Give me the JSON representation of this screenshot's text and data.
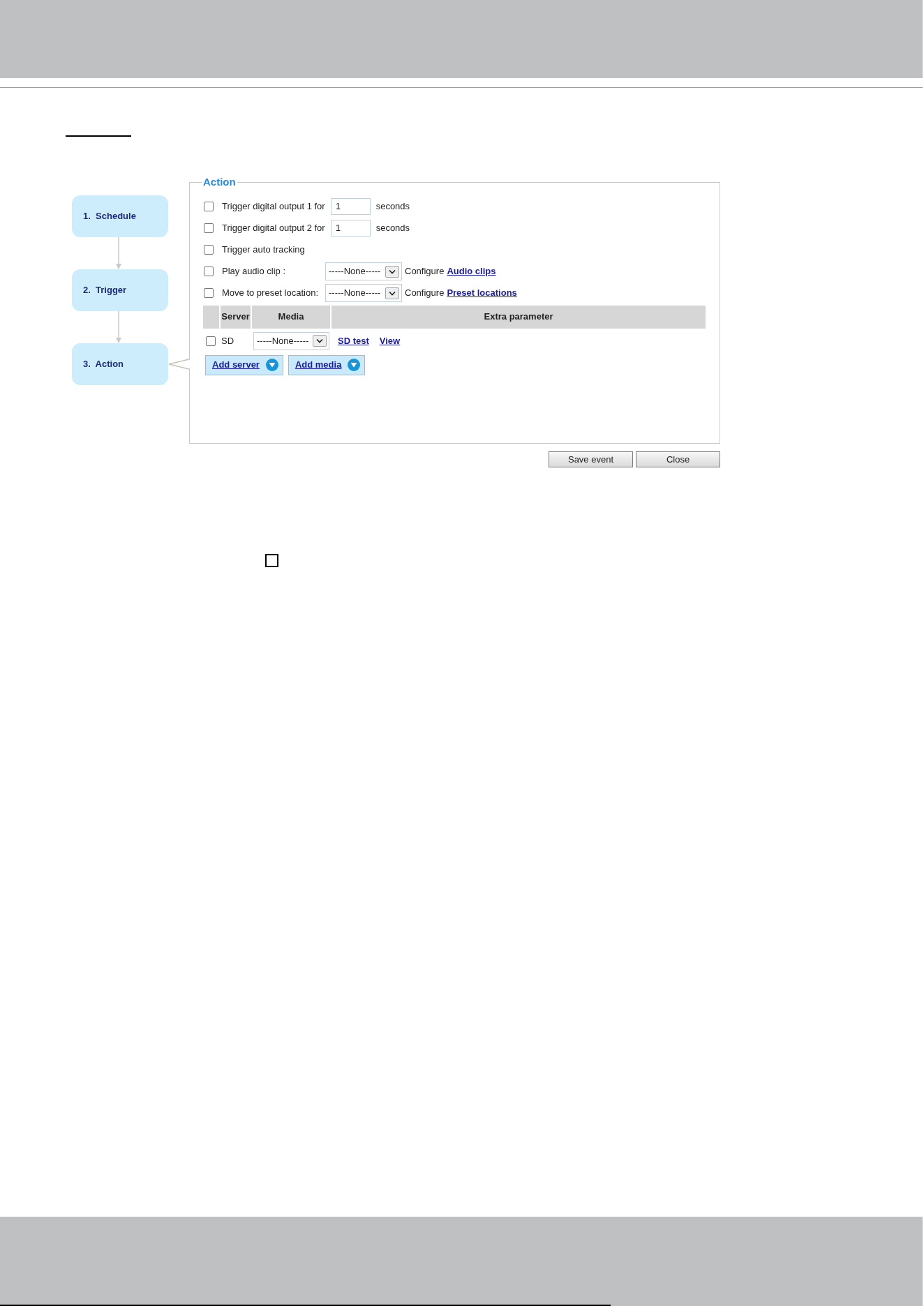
{
  "steps": [
    {
      "label": "1.  Schedule",
      "selected": false
    },
    {
      "label": "2.  Trigger",
      "selected": false
    },
    {
      "label": "3.  Action",
      "selected": true
    }
  ],
  "action_panel": {
    "legend": "Action",
    "options": [
      {
        "kind": "duration",
        "label": "Trigger digital output 1 for",
        "checked": false,
        "value": "1",
        "unit": "seconds"
      },
      {
        "kind": "duration",
        "label": "Trigger digital output 2 for",
        "checked": false,
        "value": "1",
        "unit": "seconds"
      },
      {
        "kind": "toggle",
        "label": "Trigger auto tracking",
        "checked": false
      },
      {
        "kind": "select",
        "label": "Play audio clip :",
        "checked": false,
        "value": "-----None-----",
        "prefix": "Configure",
        "link": "Audio clips"
      },
      {
        "kind": "select",
        "label": "Move to preset location:",
        "checked": false,
        "value": "-----None-----",
        "prefix": "Configure",
        "link": "Preset locations"
      }
    ],
    "table": {
      "columns": [
        "Server",
        "Media",
        "Extra parameter"
      ],
      "rows": [
        {
          "checked": false,
          "server": "SD",
          "media": "-----None-----",
          "links": [
            "SD test",
            "View"
          ]
        }
      ]
    },
    "add_buttons": [
      "Add server",
      "Add media"
    ]
  },
  "buttons": [
    "Save event",
    "Close"
  ],
  "loose_checkbox": {
    "checked": false
  }
}
